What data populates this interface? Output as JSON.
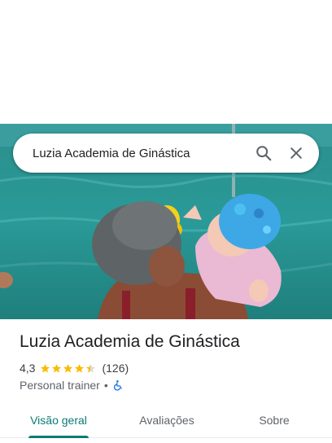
{
  "search": {
    "value": "Luzia Academia de Ginástica"
  },
  "place": {
    "name": "Luzia Academia de Ginástica",
    "rating": "4,3",
    "stars": 4.3,
    "review_count": "(126)",
    "category": "Personal trainer",
    "separator": "•"
  },
  "tabs": [
    {
      "label": "Visão geral",
      "active": true
    },
    {
      "label": "Avaliações",
      "active": false
    },
    {
      "label": "Sobre",
      "active": false
    }
  ],
  "colors": {
    "accent": "#0b7a75",
    "star": "#fbbc04",
    "accessibility": "#1a73e8"
  },
  "icons": {
    "search": "search-icon",
    "close": "close-icon",
    "accessibility": "wheelchair-icon"
  }
}
